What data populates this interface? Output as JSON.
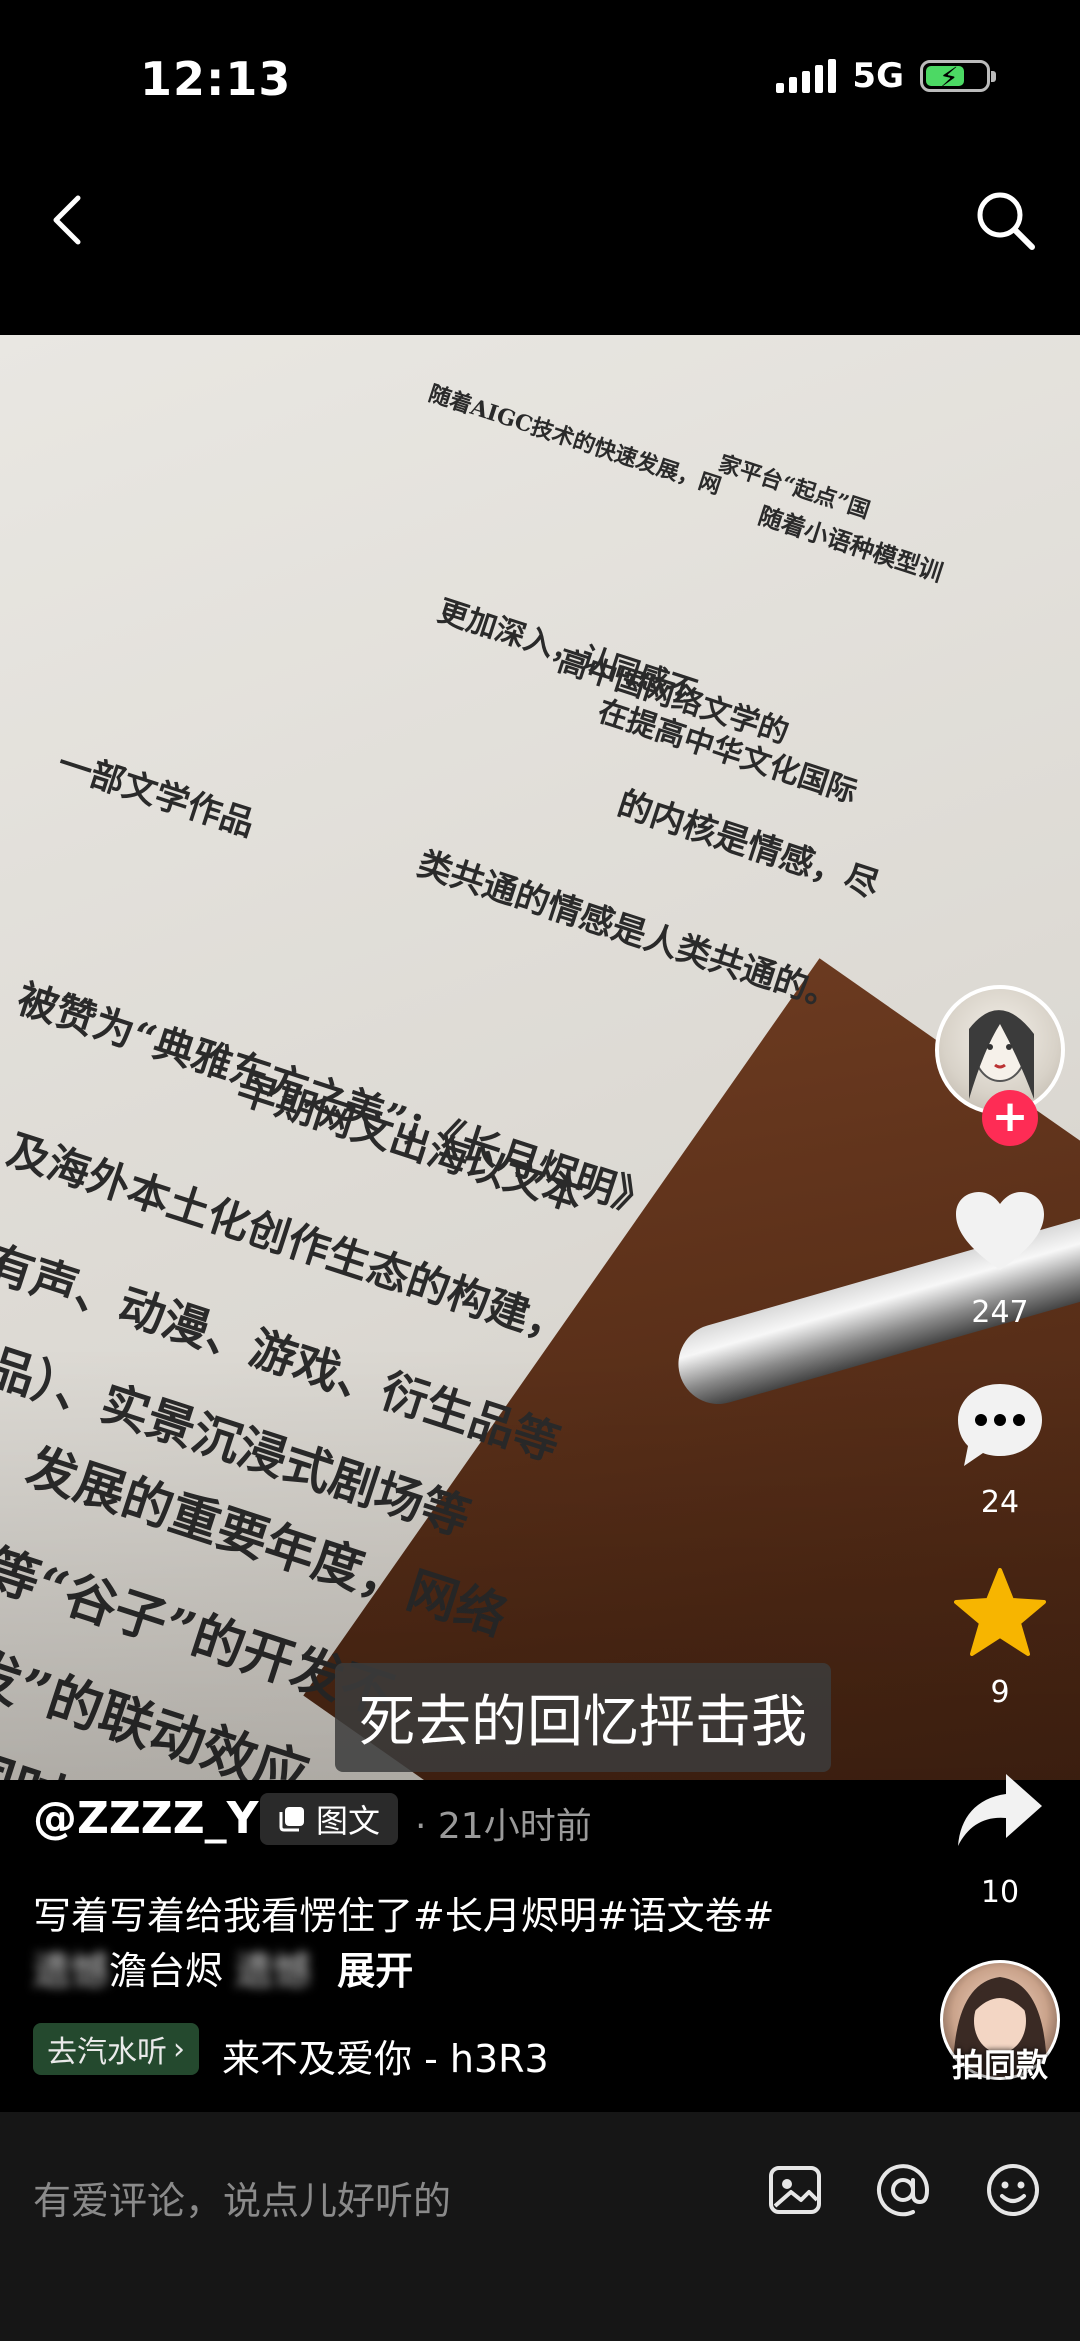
{
  "status_bar": {
    "time": "12:13",
    "network": "5G",
    "battery_level": 0.65
  },
  "header": {
    "back_icon": "chevron-left-icon",
    "search_icon": "search-icon"
  },
  "photo": {
    "document_lines": [
      "随着AIGC技术的快速发展，网",
      "家平台“起点”国",
      "随着小语种模型训",
      "更加深入，认同感不",
      "高中国网络文学的",
      "在提高中华文化国际",
      "的内核是情感，尽",
      "类共通的情感是人类共通的。",
      "一部文学作品",
      "被赞为“典雅东方之美”；《长月烬明》",
      "早期网文出海以文本",
      "及海外本土化创作生态的构建，",
      "有声、动漫、游戏、衍生品等",
      "品）、实景沉浸式剧场等",
      "发展的重要年度，网络",
      "等“谷子”的开发不",
      "发”的联动效应，",
      "同时，短剧的爆"
    ],
    "subtitle": "死去的回忆抨击我"
  },
  "actions": {
    "like_count": "247",
    "comment_count": "24",
    "favorite_count": "9",
    "share_count": "10",
    "follow_icon": "plus-icon"
  },
  "post": {
    "author": "@ZZZZ_Y",
    "type_tag": "图文",
    "time_ago": "· 21小时前",
    "caption_line1": "写着写着给我看愣住了#长月烬明#语文卷#",
    "caption_blur1": "遗憾",
    "caption_line2_mid": "澹台烬",
    "caption_blur2": "遗憾",
    "expand_label": "展开",
    "music_badge": "去汽水听",
    "music_title": "来不及爱你 - h3R3",
    "same_style_label": "拍同款"
  },
  "comment_bar": {
    "placeholder": "有爱评论，说点儿好听的"
  },
  "colors": {
    "background": "#000000",
    "follow_red": "#fe2c55",
    "favorite_yellow": "#f7b500",
    "music_badge_bg": "#24492e"
  }
}
